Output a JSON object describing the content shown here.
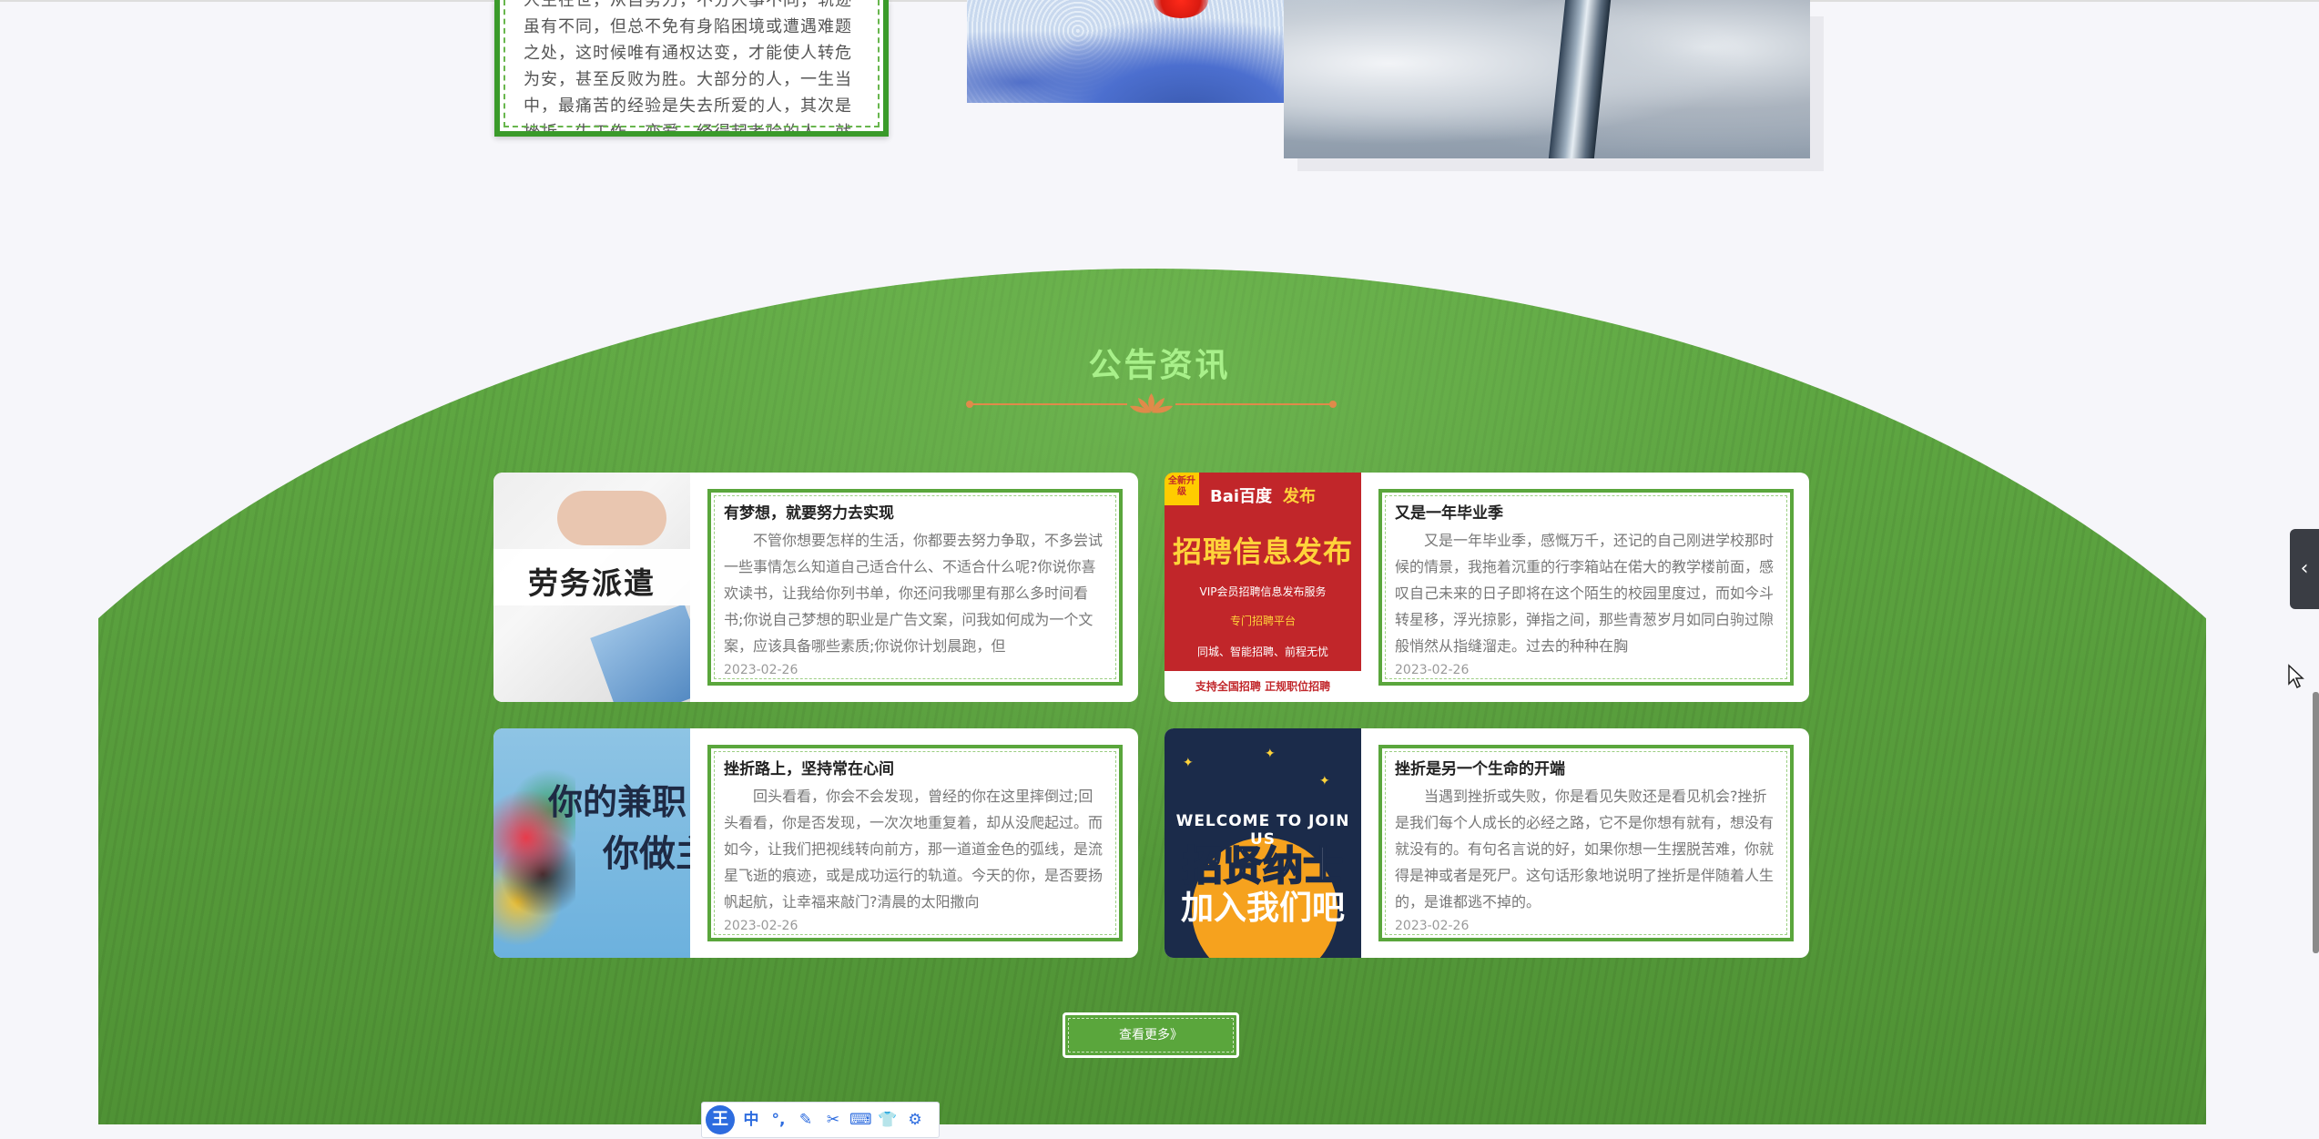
{
  "intro": {
    "text": "人生在世，从自努力，不分人事不同，轨迹虽有不同，但总不免有身陷困境或遭遇难题之处，这时候唯有通权达变，才能使人转危为安，甚至反败为胜。大部分的人，一生当中，最痛苦的经验是失去所爱的人，其次是挫折，失工作，恋爱，经得起考验的人，就"
  },
  "notices": {
    "title": "公告资讯",
    "items": [
      {
        "title": "有梦想，就要努力去实现",
        "excerpt": "不管你想要怎样的生活，你都要去努力争取，不多尝试一些事情怎么知道自己适合什么、不适合什么呢?你说你喜欢读书，让我给你列书单，你还问我哪里有那么多时间看书;你说自己梦想的职业是广告文案，问我如何成为一个文案，应该具备哪些素质;你说你计划晨跑，但",
        "date": "2023-02-26",
        "thumb_caption": "劳务派遣"
      },
      {
        "title": "又是一年毕业季",
        "excerpt": "又是一年毕业季，感慨万千，还记的自己刚进学校那时候的情景，我拖着沉重的行李箱站在偌大的教学楼前面，感叹自己未来的日子即将在这个陌生的校园里度过，而如今斗转星移，浮光掠影，弹指之间，那些青葱岁月如同白驹过隙般悄然从指缝溜走。过去的种种在胸",
        "date": "2023-02-26",
        "thumb_tag": "全新升级",
        "thumb_logo": "Bai百度",
        "thumb_logo2": "发布",
        "thumb_big": "招聘信息发布",
        "thumb_line1": "VIP会员招聘信息发布服务",
        "thumb_line2": "专门招聘平台",
        "thumb_line3": "同城、智能招聘、前程无忧",
        "thumb_bar": "支持全国招聘  正规职位招聘"
      },
      {
        "title": "挫折路上，坚持常在心间",
        "excerpt": "回头看看，你会不会发现，曾经的你在这里摔倒过;回头看看，你是否发现，一次次地重复着，却从没爬起过。而如今，让我们把视线转向前方，那一道道金色的弧线，是流星飞逝的痕迹，或是成功运行的轨道。今天的你，是否要扬帆起航，让幸福来敲门?清晨的太阳撒向",
        "date": "2023-02-26",
        "thumb_big1": "你的兼职",
        "thumb_big2": "你做主"
      },
      {
        "title": "挫折是另一个生命的开端",
        "excerpt": "当遇到挫折或失败，你是看见失败还是看见机会?挫折是我们每个人成长的必经之路，它不是你想有就有，想没有就没有的。有句名言说的好，如果你想一生摆脱苦难，你就得是神或者是死尸。这句话形象地说明了挫折是伴随着人生的，是谁都逃不掉的。",
        "date": "2023-02-26",
        "thumb_welcome": "WELCOME TO JOIN US",
        "thumb_big1": "招贤纳士",
        "thumb_big2": "加入我们吧"
      }
    ],
    "more_label": "查看更多》"
  },
  "ime": {
    "logo": "王",
    "buttons": [
      "中",
      "°,",
      "✎",
      "✂",
      "⌨",
      "👕",
      "⚙"
    ]
  },
  "side_tab": {
    "icon": "chevron-left-icon",
    "glyph": "‹"
  },
  "colors": {
    "section_green": "#5aa63c",
    "title_green": "#a8f08a",
    "ornament_orange": "#e08a4a",
    "card_border": "#5aa63c"
  }
}
